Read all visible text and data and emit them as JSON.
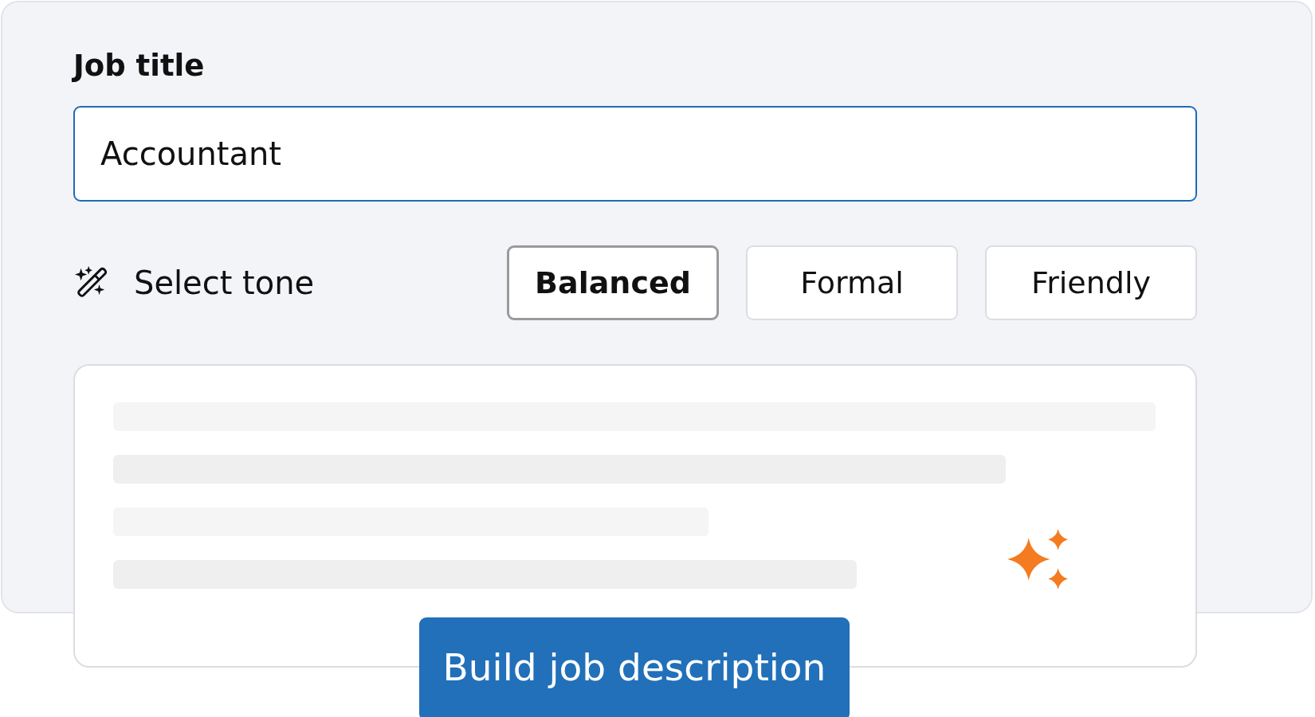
{
  "job_title": {
    "label": "Job title",
    "value": "Accountant"
  },
  "tone": {
    "label": "Select tone",
    "options": [
      {
        "label": "Balanced",
        "selected": true
      },
      {
        "label": "Formal",
        "selected": false
      },
      {
        "label": "Friendly",
        "selected": false
      }
    ]
  },
  "buttons": [
    "Build job description"
  ]
}
